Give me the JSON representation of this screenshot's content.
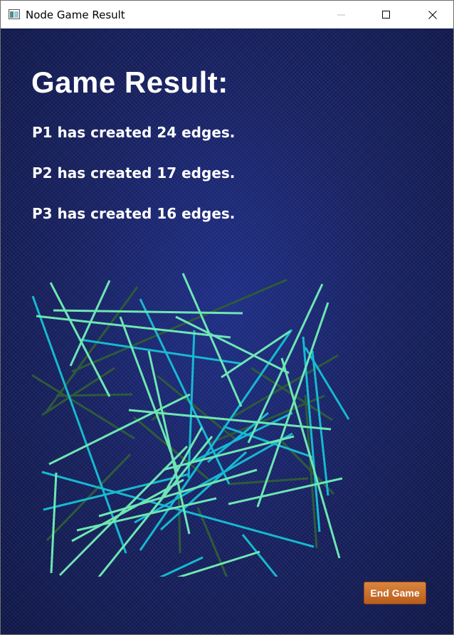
{
  "window": {
    "title": "Node Game Result",
    "app_icon": "window-app-icon",
    "controls": [
      "minimize-icon",
      "maximize-icon",
      "close-icon"
    ]
  },
  "heading": "Game Result:",
  "results": [
    "P1 has created 24 edges.",
    "P2 has created 17 edges.",
    "P3 has created 16 edges."
  ],
  "end_button_label": "End Game",
  "colors": {
    "background": "#16205f",
    "p1_edge": "#6ee6b4",
    "p2_edge": "#17b9cf",
    "p3_edge": "#2e5a3a",
    "button": "#c96d2b"
  }
}
